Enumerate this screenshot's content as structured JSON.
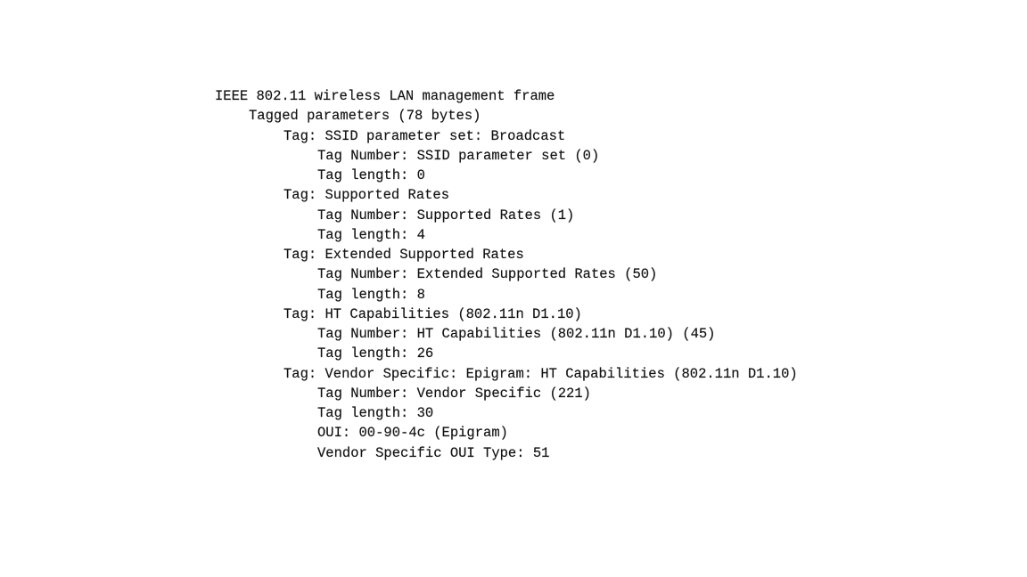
{
  "frame": {
    "title": "IEEE 802.11 wireless LAN management frame",
    "tagged_parameters": "Tagged parameters (78 bytes)",
    "tags": [
      {
        "header": "Tag: SSID parameter set: Broadcast",
        "number": "Tag Number: SSID parameter set (0)",
        "length": "Tag length: 0"
      },
      {
        "header": "Tag: Supported Rates",
        "number": "Tag Number: Supported Rates (1)",
        "length": "Tag length: 4"
      },
      {
        "header": "Tag: Extended Supported Rates",
        "number": "Tag Number: Extended Supported Rates (50)",
        "length": "Tag length: 8"
      },
      {
        "header": "Tag: HT Capabilities (802.11n D1.10)",
        "number": "Tag Number: HT Capabilities (802.11n D1.10) (45)",
        "length": "Tag length: 26"
      },
      {
        "header": "Tag: Vendor Specific: Epigram: HT Capabilities (802.11n D1.10)",
        "number": "Tag Number: Vendor Specific (221)",
        "length": "Tag length: 30",
        "oui": "OUI: 00-90-4c (Epigram)",
        "oui_type": "Vendor Specific OUI Type: 51"
      }
    ]
  }
}
